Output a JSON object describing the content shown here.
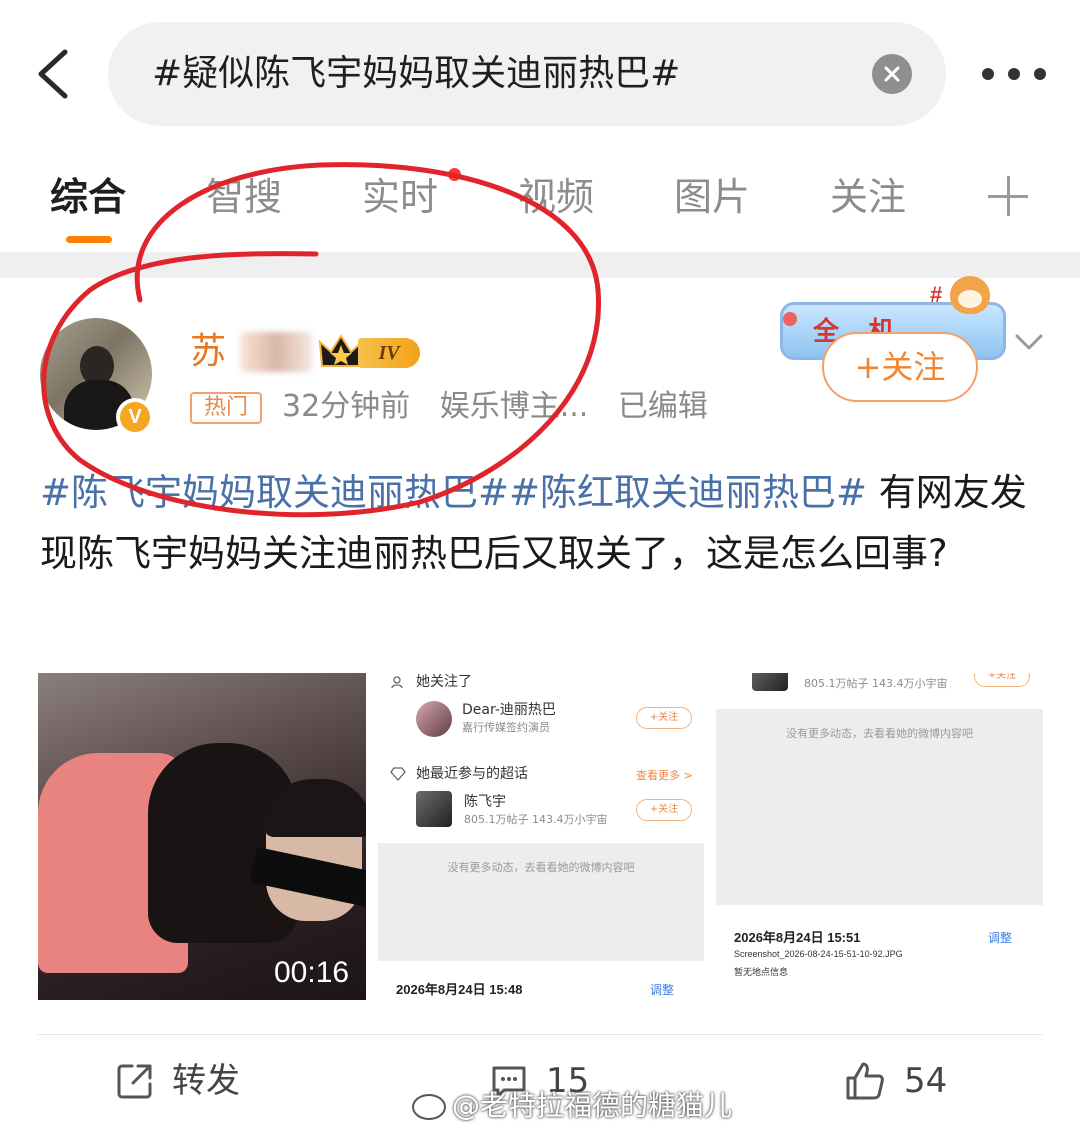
{
  "search": {
    "query": "#疑似陈飞宇妈妈取关迪丽热巴#"
  },
  "tabs": [
    {
      "label": "综合",
      "active": true
    },
    {
      "label": "智搜",
      "active": false
    },
    {
      "label": "实时",
      "active": false,
      "has_dot": true
    },
    {
      "label": "视频",
      "active": false
    },
    {
      "label": "图片",
      "active": false
    },
    {
      "label": "关注",
      "active": false
    }
  ],
  "post": {
    "username": "苏",
    "level_badge": "IV",
    "hot_tag": "热门",
    "time": "32分钟前",
    "source": "娱乐博主...",
    "edited": "已编辑",
    "follow_label": "+关注",
    "promo_text": "全...机",
    "body": {
      "hashtag1": "#陈飞宇妈妈取关迪丽热巴#",
      "hashtag2": "#陈红取关迪丽热巴#",
      "text": " 有网友发现陈飞宇妈妈关注迪丽热巴后又取关了，这是怎么回事?"
    }
  },
  "media": {
    "video_duration": "00:16",
    "screenshot1": {
      "following_header": "她关注了",
      "user1_name": "Dear-迪丽热巴",
      "user1_desc": "嘉行传媒签约演员",
      "follow_small": "+关注",
      "topics_header": "她最近参与的超话",
      "see_more": "查看更多 >",
      "user2_name": "陈飞宇",
      "user2_desc": "805.1万帖子 143.4万小宇宙",
      "empty_text": "没有更多动态，去看看她的微博内容吧",
      "date": "2026年8月24日 15:48",
      "adjust": "调整"
    },
    "screenshot2": {
      "top_desc": "805.1万帖子 143.4万小宇宙",
      "follow_small": "+关注",
      "empty_text": "没有更多动态，去看看她的微博内容吧",
      "date": "2026年8月24日 15:51",
      "adjust": "调整",
      "filename": "Screenshot_2026-08-24-15-51-10-92.JPG",
      "location": "暂无地点信息"
    }
  },
  "actions": {
    "repost_label": "转发",
    "comment_count": "15",
    "like_count": "54"
  },
  "watermark": "@老特拉福德的糖猫儿",
  "colors": {
    "accent_orange": "#ff8200",
    "hashtag_blue": "#4a70a8",
    "annotation_red": "#e0242b"
  }
}
